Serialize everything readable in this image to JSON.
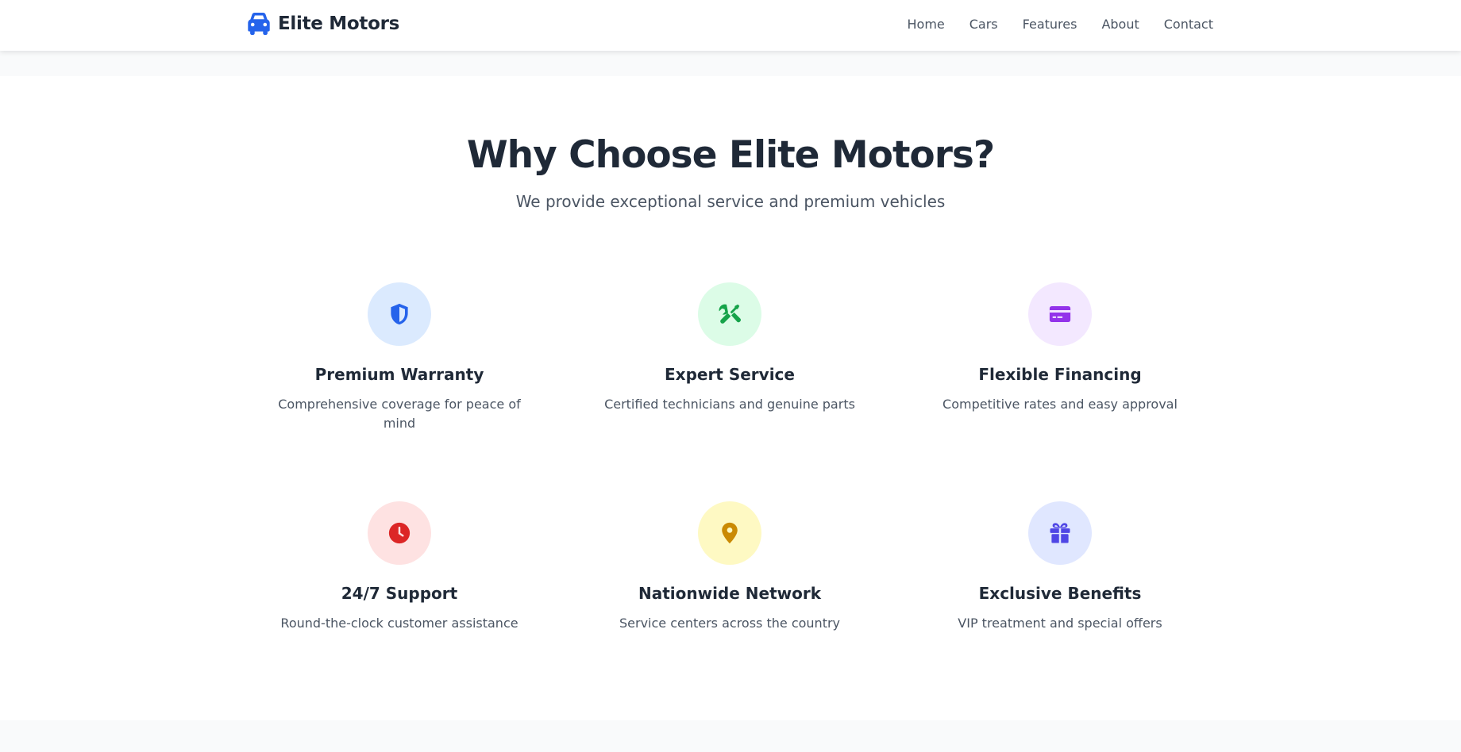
{
  "nav": {
    "brand": "Elite Motors",
    "brand_icon": "car-icon",
    "links": [
      "Home",
      "Cars",
      "Features",
      "About",
      "Contact"
    ]
  },
  "section": {
    "title": "Why Choose Elite Motors?",
    "subtitle": "We provide exceptional service and premium vehicles"
  },
  "features": [
    {
      "icon": "shield-icon",
      "title": "Premium Warranty",
      "description": "Comprehensive coverage for peace of mind",
      "icon_color": "#2563eb",
      "bg_color": "#dbeafe"
    },
    {
      "icon": "tools-icon",
      "title": "Expert Service",
      "description": "Certified technicians and genuine parts",
      "icon_color": "#16a34a",
      "bg_color": "#dcfce7"
    },
    {
      "icon": "credit-card-icon",
      "title": "Flexible Financing",
      "description": "Competitive rates and easy approval",
      "icon_color": "#9333ea",
      "bg_color": "#f3e8ff"
    },
    {
      "icon": "clock-icon",
      "title": "24/7 Support",
      "description": "Round-the-clock customer assistance",
      "icon_color": "#dc2626",
      "bg_color": "#fee2e2"
    },
    {
      "icon": "map-pin-icon",
      "title": "Nationwide Network",
      "description": "Service centers across the country",
      "icon_color": "#ca8a04",
      "bg_color": "#fef9c3"
    },
    {
      "icon": "gift-icon",
      "title": "Exclusive Benefits",
      "description": "VIP treatment and special offers",
      "icon_color": "#4f46e5",
      "bg_color": "#e0e7ff"
    }
  ],
  "colors": {
    "accent": "#2563eb",
    "heading": "#1f2937",
    "body_text": "#4b5563"
  }
}
